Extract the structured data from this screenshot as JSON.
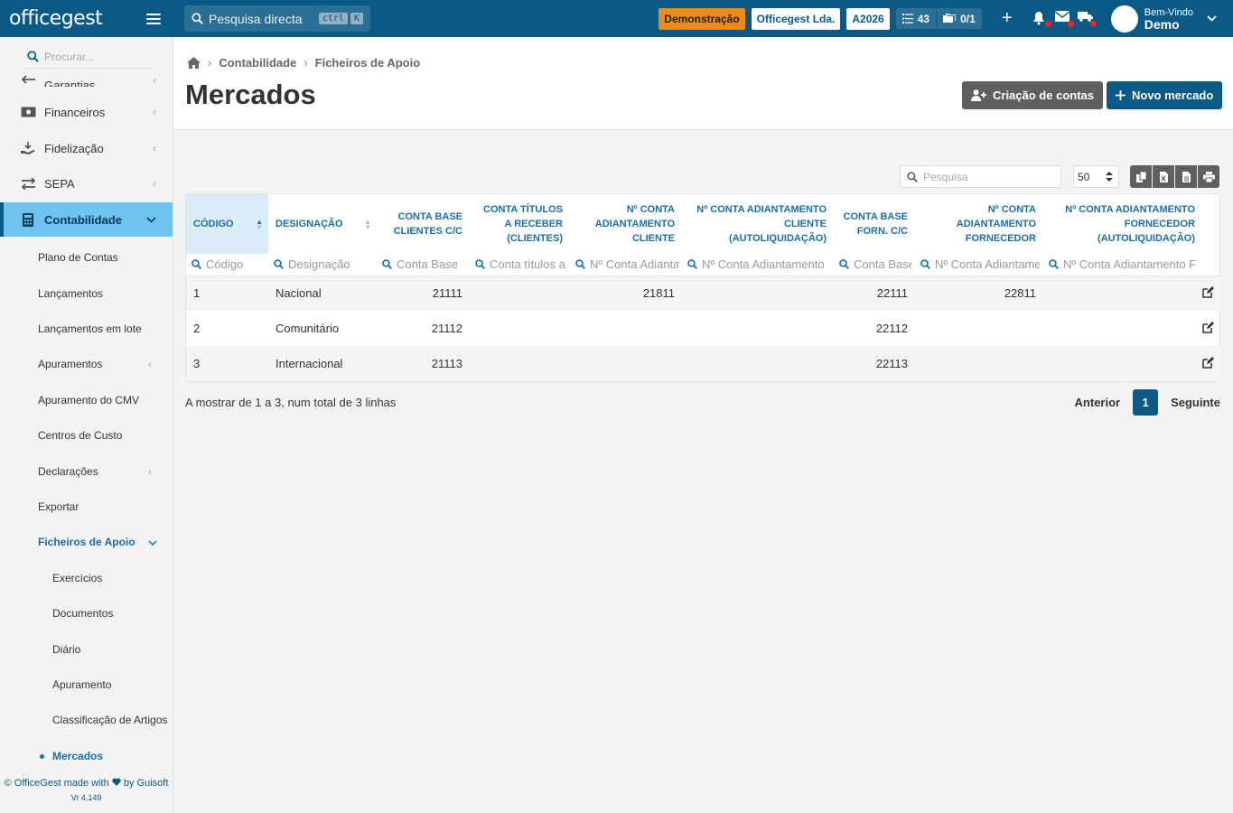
{
  "app": {
    "logo_text": "officegest",
    "top_search_placeholder": "Pesquisa directa",
    "kbd_ctrl": "ctrl",
    "kbd_k": "K",
    "badge_demo": "Demonstração",
    "company": "Officegest Lda.",
    "year_badge": "A2026",
    "tasks_count": "43",
    "docs_count": "0/1",
    "plus_label": "+",
    "welcome": "Bem-Vindo",
    "user_name": "Demo",
    "colors": {
      "topbar": "#0a5a85",
      "accent": "#1a6ea8",
      "active_menu": "#6ec3ef",
      "demo_badge": "#ec8a1a"
    }
  },
  "sidebar": {
    "search_placeholder": "Procurar...",
    "items": [
      {
        "label": "Garantias",
        "icon": "arrow-left-icon"
      },
      {
        "label": "Financeiros",
        "icon": "money-icon"
      },
      {
        "label": "Fidelização",
        "icon": "hand-icon"
      },
      {
        "label": "SEPA",
        "icon": "exchange-icon"
      },
      {
        "label": "Contabilidade",
        "icon": "calculator-icon"
      }
    ],
    "sub_items": [
      "Plano de Contas",
      "Lançamentos",
      "Lançamentos em lote",
      "Apuramentos",
      "Apuramento do CMV",
      "Centros de Custo",
      "Declarações",
      "Exportar",
      "Ficheiros de Apoio"
    ],
    "sub2_items": [
      "Exercícios",
      "Documentos",
      "Diário",
      "Apuramento",
      "Classificação de Artigos",
      "Mercados"
    ],
    "footer_line1": "© OfficeGest made with",
    "footer_line1b": "by Guisoft",
    "footer_version": "Vr 4.149"
  },
  "breadcrumb": [
    "Contabilidade",
    "Ficheiros de Apoio"
  ],
  "page_title": "Mercados",
  "buttons": {
    "create_accounts": "Criação de contas",
    "new_market": "Novo mercado"
  },
  "table_tools": {
    "search_placeholder": "Pesquisa",
    "page_size": "50"
  },
  "table": {
    "columns": [
      {
        "label": "CÓDIGO",
        "filter": "Código"
      },
      {
        "label": "DESIGNAÇÃO",
        "filter": "Designação"
      },
      {
        "label": "CONTA BASE CLIENTES C/C",
        "filter": "Conta Base"
      },
      {
        "label": "CONTA TÍTULOS A RECEBER (CLIENTES)",
        "filter": "Conta títulos a"
      },
      {
        "label": "Nº CONTA ADIANTAMENTO CLIENTE",
        "filter": "Nº Conta Adiantamento"
      },
      {
        "label": "Nº CONTA ADIANTAMENTO CLIENTE (AUTOLIQUIDAÇÃO)",
        "filter": "Nº Conta Adiantamento"
      },
      {
        "label": "CONTA BASE FORN. C/C",
        "filter": "Conta Base"
      },
      {
        "label": "Nº CONTA ADIANTAMENTO FORNECEDOR",
        "filter": "Nº Conta Adiantamento"
      },
      {
        "label": "Nº CONTA ADIANTAMENTO FORNECEDOR (AUTOLIQUIDAÇÃO)",
        "filter": "Nº Conta Adiantamento F"
      }
    ],
    "rows": [
      {
        "codigo": "1",
        "designacao": "Nacional",
        "base_clientes": "21111",
        "titulos": "",
        "adi_cliente": "21811",
        "adi_cliente_auto": "",
        "base_forn": "22111",
        "adi_forn": "22811",
        "adi_forn_auto": ""
      },
      {
        "codigo": "2",
        "designacao": "Comunitário",
        "base_clientes": "21112",
        "titulos": "",
        "adi_cliente": "",
        "adi_cliente_auto": "",
        "base_forn": "22112",
        "adi_forn": "",
        "adi_forn_auto": ""
      },
      {
        "codigo": "3",
        "designacao": "Internacional",
        "base_clientes": "21113",
        "titulos": "",
        "adi_cliente": "",
        "adi_cliente_auto": "",
        "base_forn": "22113",
        "adi_forn": "",
        "adi_forn_auto": ""
      }
    ]
  },
  "footer": {
    "info": "A mostrar de 1 a 3, num total de 3 linhas",
    "prev": "Anterior",
    "current_page": "1",
    "next": "Seguinte"
  }
}
